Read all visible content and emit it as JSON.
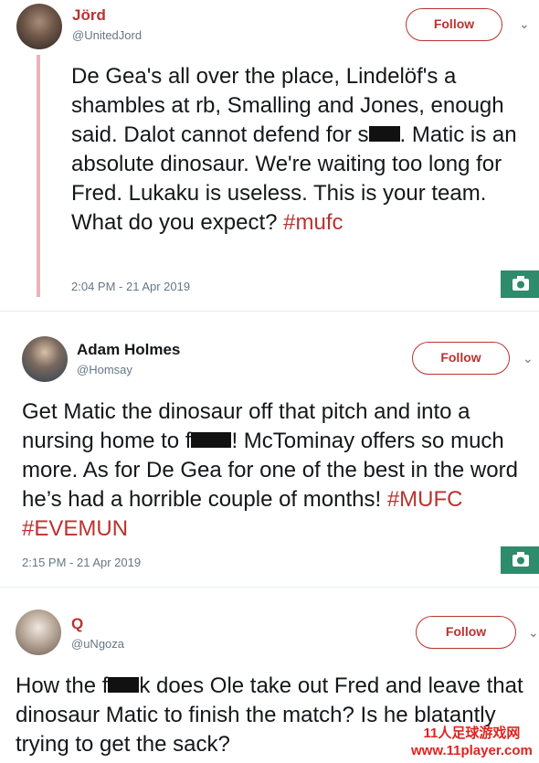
{
  "tweet1": {
    "name": "Jörd",
    "handle": "@UnitedJord",
    "follow_label": "Follow",
    "segments": [
      "De Gea's all over the place, Lindelöf's a shambles at rb, Smalling and Jones, enough said. Dalot cannot defend for s",
      ". Matic is an absolute dinosaur. We're waiting too long for Fred. Lukaku is useless. This  is your team. What do you expect? "
    ],
    "hashtag": "#mufc",
    "timestamp": "2:04 PM - 21 Apr 2019"
  },
  "tweet2": {
    "name": "Adam Holmes",
    "handle": "@Homsay",
    "follow_label": "Follow",
    "segments": [
      "Get Matic the dinosaur off that pitch and into a nursing home to f",
      "! McTominay offers so much more. As for De Gea for one of the best in the word he’s had a horrible couple of months! "
    ],
    "hashtags": [
      "#MUFC",
      "#EVEMUN"
    ],
    "timestamp": "2:15 PM - 21 Apr 2019"
  },
  "tweet3": {
    "name": "Q",
    "handle": "@uNgoza",
    "follow_label": "Follow",
    "segments": [
      "How the f",
      "k does Ole take out Fred and leave that dinosaur Matic to finish the match? Is he blatantly trying to get the sack?"
    ]
  },
  "watermark": {
    "line1": "11人足球游戏网",
    "line2": "www.11player.com"
  },
  "colors": {
    "accent": "#b8332f",
    "camera": "#2e8b6b",
    "thread_line": "#e8b4bc"
  },
  "icons": {
    "chevron": "chevron-down-icon",
    "camera": "camera-icon"
  }
}
